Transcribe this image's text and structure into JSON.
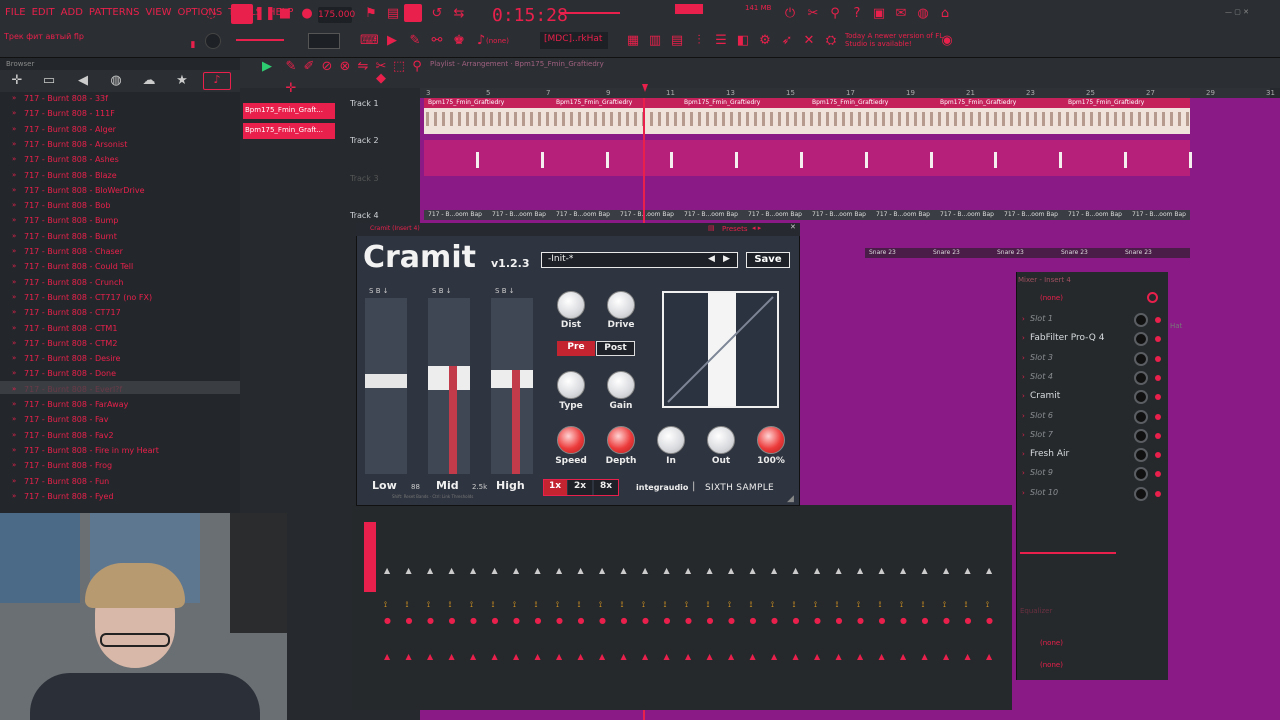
{
  "menu": [
    "FILE",
    "EDIT",
    "ADD",
    "PATTERNS",
    "VIEW",
    "OPTIONS",
    "TOOLS",
    "HELP"
  ],
  "transport": {
    "bpm": "175.000",
    "time": "0:15:28",
    "ram": "141 MB",
    "pattern": "[MDC]..rkHat",
    "snap": "(none)"
  },
  "project_name": "Трек фит автый flp",
  "update_hint": "Today  A newer version of FL Studio is available!",
  "playlist_title": "Playlist - Arrangement · Bpm175_Fmin_Graftiedry",
  "browser": {
    "title": "Browser",
    "items": [
      "717 - Burnt 808 - 33f",
      "717 - Burnt 808 - 111F",
      "717 - Burnt 808 - Alger",
      "717 - Burnt 808 - Arsonist",
      "717 - Burnt 808 - Ashes",
      "717 - Burnt 808 - Blaze",
      "717 - Burnt 808 - BloWerDrive",
      "717 - Burnt 808 - Bob",
      "717 - Burnt 808 - Bump",
      "717 - Burnt 808 - Burnt",
      "717 - Burnt 808 - Chaser",
      "717 - Burnt 808 - Could Tell",
      "717 - Burnt 808 - Crunch",
      "717 - Burnt 808 - CT717 (no FX)",
      "717 - Burnt 808 - CT717",
      "717 - Burnt 808 - CTM1",
      "717 - Burnt 808 - CTM2",
      "717 - Burnt 808 - Desire",
      "717 - Burnt 808 - Done",
      "717 - Burnt 808 - Everl?f",
      "717 - Burnt 808 - FarAway",
      "717 - Burnt 808 - Fav",
      "717 - Burnt 808 - Fav2",
      "717 - Burnt 808 - Fire in my Heart",
      "717 - Burnt 808 - Frog",
      "717 - Burnt 808 - Fun",
      "717 - Burnt 808 - Fyed"
    ],
    "selected_index": 19
  },
  "patterns": [
    "Bpm175_Fmin_Graft...",
    "Bpm175_Fmin_Graft..."
  ],
  "tracks": [
    "Track 1",
    "Track 2",
    "Track 3",
    "Track 4"
  ],
  "ruler": [
    "3",
    "5",
    "7",
    "9",
    "11",
    "13",
    "15",
    "17",
    "19",
    "21",
    "23",
    "25",
    "27",
    "29",
    "31"
  ],
  "clip_label": "Bpm175_Fmin_Graftiedry",
  "track4_clip": "717 - B...oom Bap",
  "snare_clip": "Snare 23",
  "plugin": {
    "window_title": "Cramit (Insert 4)",
    "presets_label": "Presets",
    "name": "Cramit",
    "version": "v1.2.3",
    "preset": "-Init-*",
    "save": "Save",
    "bands": [
      "Low",
      "Mid",
      "High"
    ],
    "crossover": [
      "88",
      "2.5k"
    ],
    "band_buttons": [
      "S",
      "B"
    ],
    "knobs_row1": [
      "Dist",
      "Drive"
    ],
    "pre": "Pre",
    "post": "Post",
    "knobs_row2": [
      "Type",
      "Gain"
    ],
    "knobs_row3": [
      "Speed",
      "Depth",
      "In",
      "Out",
      "100%"
    ],
    "oversampling": [
      "1x",
      "2x",
      "8x"
    ],
    "brand1": "integraudio",
    "brand2": "SIXTH SAMPLE",
    "footnote": "Shift: Reset Bands · Ctrl: Link Thresholds"
  },
  "mixer": {
    "title": "Mixer - Insert 4",
    "input": "(none)",
    "slots": [
      "Slot 1",
      "FabFilter Pro-Q 4",
      "Slot 3",
      "Slot 4",
      "Cramit",
      "Slot 6",
      "Slot 7",
      "Fresh Air",
      "Slot 9",
      "Slot 10"
    ],
    "eq_label": "Equalizer",
    "out1": "(none)",
    "out2": "(none)",
    "hat_label": "Hat"
  },
  "colors": {
    "accent": "#e8204b",
    "playlist_bg": "#8a1a86",
    "plugin_bg": "#2f3540"
  }
}
